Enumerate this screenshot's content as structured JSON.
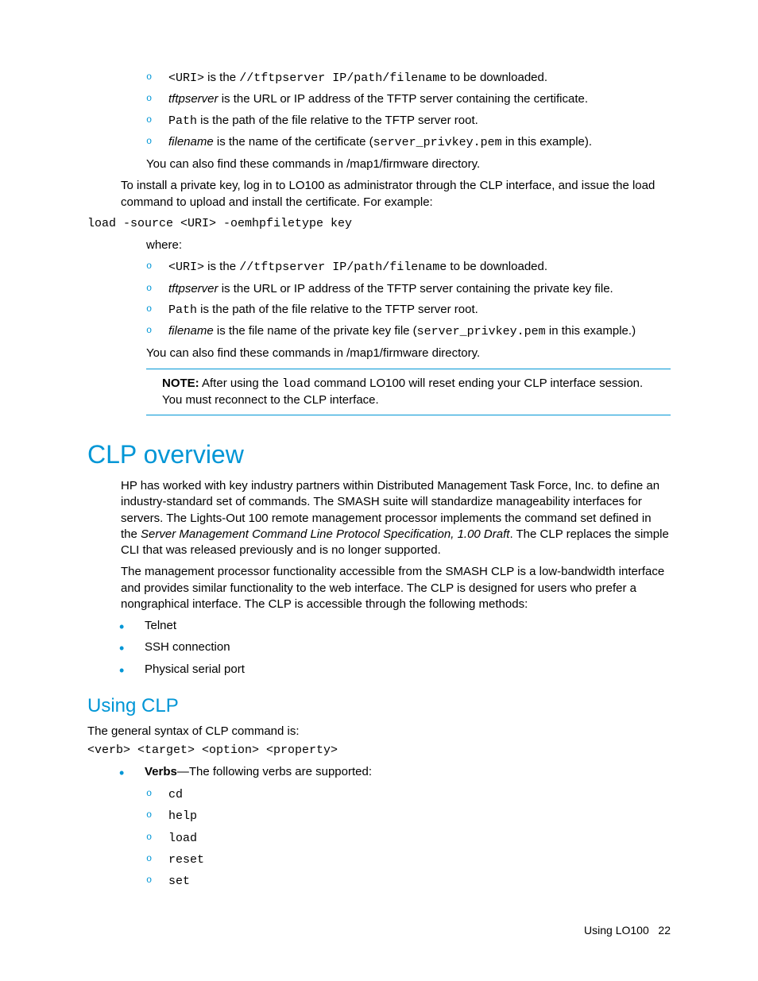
{
  "top": {
    "sub1": [
      {
        "pre": "<URI>",
        "mid": " is the ",
        "code": "//tftpserver IP/path/filename",
        "post": " to be downloaded."
      },
      {
        "ital": "tftpserver",
        "plain": " is the URL or IP address of the TFTP server containing the certificate."
      },
      {
        "code1": "Path",
        "plain": " is the path of the file relative to the TFTP server root."
      },
      {
        "ital": "filename",
        "plain1": " is the name of the certificate (",
        "code1": "server_privkey.pem",
        "plain2": " in this example)."
      }
    ],
    "after1": "You can also find these commands in /map1/firmware directory.",
    "para2": "To install a private key, log in to LO100 as administrator through the CLP interface, and issue the load command to upload and install the certificate. For example:",
    "cmd": "load -source <URI> -oemhpfiletype key",
    "where": "where:",
    "sub2": [
      {
        "pre": "<URI>",
        "mid": " is the ",
        "code": "//tftpserver IP/path/filename",
        "post": " to be downloaded."
      },
      {
        "ital": "tftpserver",
        "plain": " is the URL or IP address of the TFTP server containing the private key file."
      },
      {
        "code1": "Path",
        "plain": " is the path of the file relative to the TFTP server root."
      },
      {
        "ital": "filename",
        "plain1": " is the file name of the private key file (",
        "code1": "server_privkey.pem",
        "plain2": " in this example.)"
      }
    ],
    "after2": "You can also find these commands in /map1/firmware directory.",
    "note_label": "NOTE:",
    "note_body1": "  After using the ",
    "note_code": "load",
    "note_body2": " command LO100 will reset ending your CLP interface session. You must reconnect to the CLP interface."
  },
  "clp": {
    "h": "CLP overview",
    "p1a": "HP has worked with key industry partners within Distributed Management Task Force, Inc. to define an industry-standard set of commands. The SMASH suite will standardize manageability interfaces for servers. The Lights-Out 100 remote management processor implements the command set defined in the ",
    "p1i": "Server Management Command Line Protocol Specification, 1.00 Draft",
    "p1b": ". The CLP replaces the simple CLI that was released previously and is no longer supported.",
    "p2": "The management processor functionality accessible from the SMASH CLP is a low-bandwidth interface and provides similar functionality to the web interface. The CLP is designed for users who prefer a nongraphical interface. The CLP is accessible through the following methods:",
    "methods": [
      "Telnet",
      "SSH connection",
      "Physical serial port"
    ]
  },
  "using": {
    "h": "Using CLP",
    "p1": "The general syntax of CLP command is:",
    "syntax": "<verb> <target> <option> <property>",
    "verbs_label": "Verbs",
    "verbs_tail": "—The following verbs are supported:",
    "verbs": [
      "cd",
      "help",
      "load",
      "reset",
      "set"
    ]
  },
  "footer": {
    "label": "Using LO100",
    "page": "22"
  }
}
